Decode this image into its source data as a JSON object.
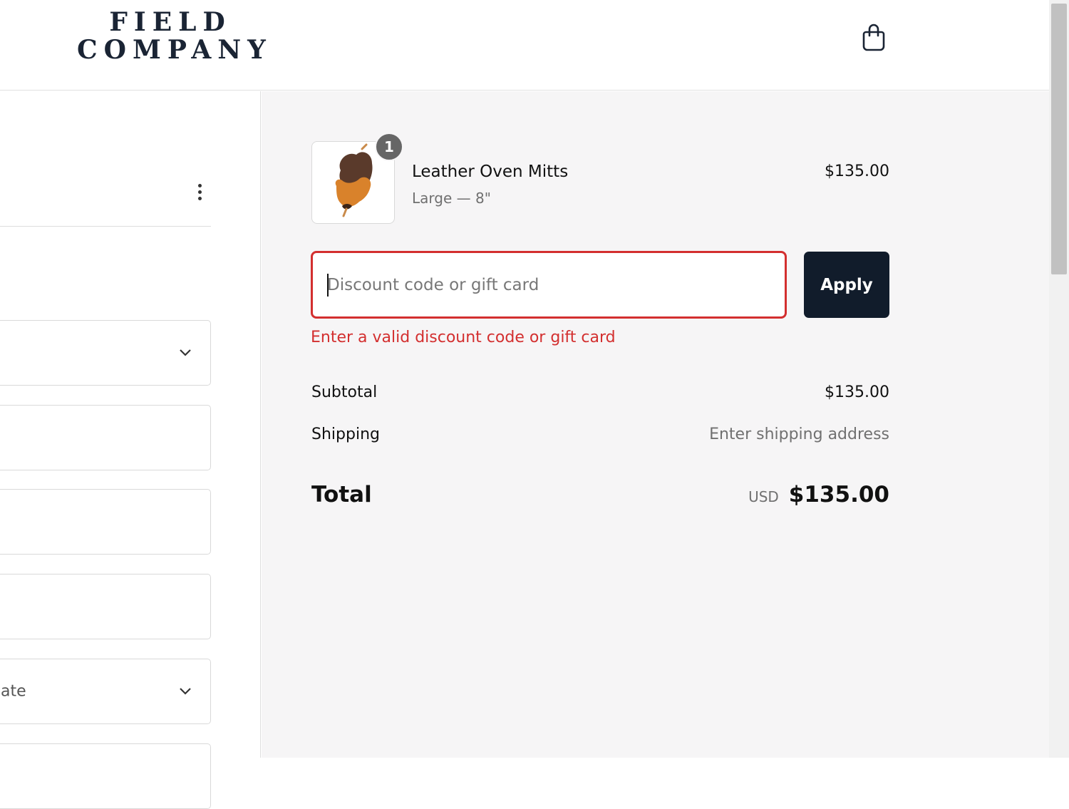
{
  "brand": {
    "line1": "FIELD",
    "line2": "COMPANY"
  },
  "header": {
    "cart_icon": "shopping-bag-icon"
  },
  "left": {
    "menu_icon": "more-vertical-icon",
    "fields": [
      {
        "kind": "select",
        "text": ""
      },
      {
        "kind": "text",
        "text": ""
      },
      {
        "kind": "text",
        "text": ""
      },
      {
        "kind": "text",
        "text": ""
      },
      {
        "kind": "select",
        "text": "ate"
      },
      {
        "kind": "text",
        "text": ""
      }
    ]
  },
  "order": {
    "item": {
      "quantity": "1",
      "name": "Leather Oven Mitts",
      "variant": "Large — 8\"",
      "price": "$135.00"
    },
    "discount": {
      "placeholder": "Discount code or gift card",
      "value": "",
      "apply_label": "Apply",
      "error": "Enter a valid discount code or gift card"
    },
    "summary": {
      "subtotal_label": "Subtotal",
      "subtotal_value": "$135.00",
      "shipping_label": "Shipping",
      "shipping_value": "Enter shipping address",
      "total_label": "Total",
      "currency": "USD",
      "total_value": "$135.00"
    }
  },
  "colors": {
    "brand_navy": "#1a2434",
    "button_dark": "#111c2b",
    "error_red": "#d32f2f",
    "panel_bg": "#f6f5f6"
  }
}
